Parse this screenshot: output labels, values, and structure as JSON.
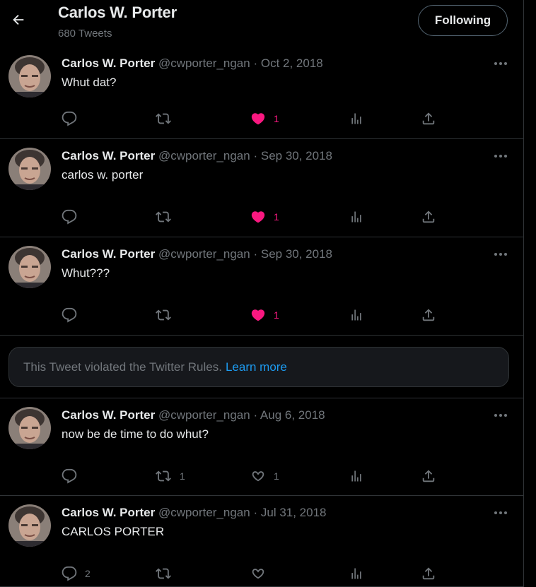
{
  "header": {
    "name": "Carlos W. Porter",
    "tweet_count": "680 Tweets",
    "follow_label": "Following"
  },
  "author": {
    "name": "Carlos W. Porter",
    "handle": "@cwporter_ngan",
    "sep": "·"
  },
  "tweets": [
    {
      "date": "Oct 2, 2018",
      "text": "Whut dat?",
      "replies": "",
      "retweets": "",
      "likes": "1",
      "liked": true
    },
    {
      "date": "Sep 30, 2018",
      "text": "carlos w. porter",
      "replies": "",
      "retweets": "",
      "likes": "1",
      "liked": true
    },
    {
      "date": "Sep 30, 2018",
      "text": "Whut???",
      "replies": "",
      "retweets": "",
      "likes": "1",
      "liked": true
    },
    {
      "date": "Aug 6, 2018",
      "text": "now be de time to do whut?",
      "replies": "",
      "retweets": "1",
      "likes": "1",
      "liked": false
    },
    {
      "date": "Jul 31, 2018",
      "text": "CARLOS PORTER",
      "replies": "2",
      "retweets": "",
      "likes": "",
      "liked": false
    }
  ],
  "violation": {
    "text": "This Tweet violated the Twitter Rules.",
    "link": "Learn more"
  },
  "icons": {
    "back": "arrow-left-icon",
    "more": "more-dots-icon",
    "reply": "reply-icon",
    "retweet": "retweet-icon",
    "like": "heart-icon",
    "views": "views-icon",
    "share": "share-icon"
  },
  "colors": {
    "bg": "#000000",
    "text": "#e7e9ea",
    "muted": "#71767b",
    "like": "#f91880",
    "link": "#1d9bf0",
    "border": "#2f3336"
  }
}
